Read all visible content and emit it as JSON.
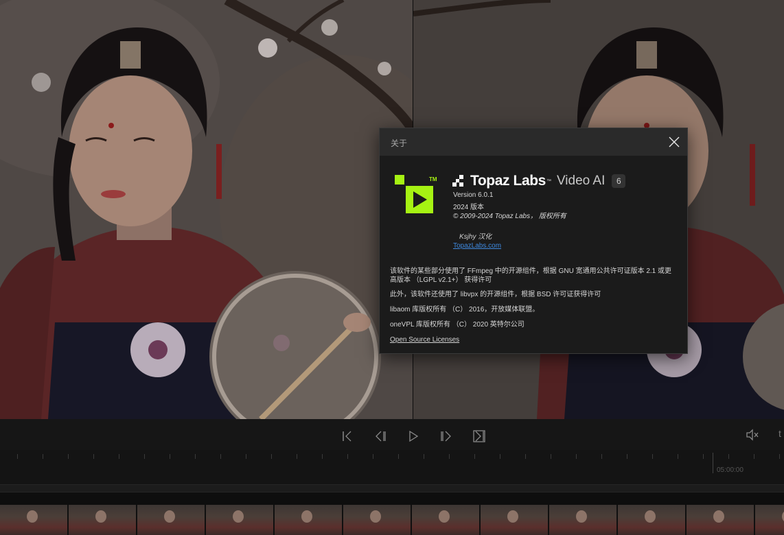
{
  "dialog": {
    "title": "关于",
    "brand_name": "Topaz Labs",
    "brand_tm": "™",
    "product_name": "Video AI",
    "version_badge": "6",
    "logo_tm": "TM",
    "version_line": "Version 6.0.1",
    "year_line": "2024 版本",
    "copyright_line": "© 2009-2024 Topaz Labs， 版权所有",
    "localization_credit": "Ksjhy 汉化",
    "website_link": "TopazLabs.com",
    "license_para_1": "该软件的某些部分使用了 FFmpeg 中的开源组件，根据 GNU 宽通用公共许可证版本 2.1 或更高版本 （LGPL v2.1+） 获得许可",
    "license_para_2": "此外，该软件还使用了 libvpx 的开源组件，根据 BSD 许可证获得许可",
    "license_para_3": "libaom 库版权所有 （C） 2016，开放媒体联盟。",
    "license_para_4": "oneVPL 库版权所有 （C） 2020 英特尔公司",
    "open_source_link": "Open Source Licenses",
    "accent_color": "#a6f213"
  },
  "transport": {
    "buttons": [
      "skip-to-start",
      "previous-frame",
      "play",
      "next-frame",
      "skip-to-end"
    ],
    "mute_icon": "speaker-muted-icon"
  },
  "timeline": {
    "timecode": "05:00:00"
  }
}
